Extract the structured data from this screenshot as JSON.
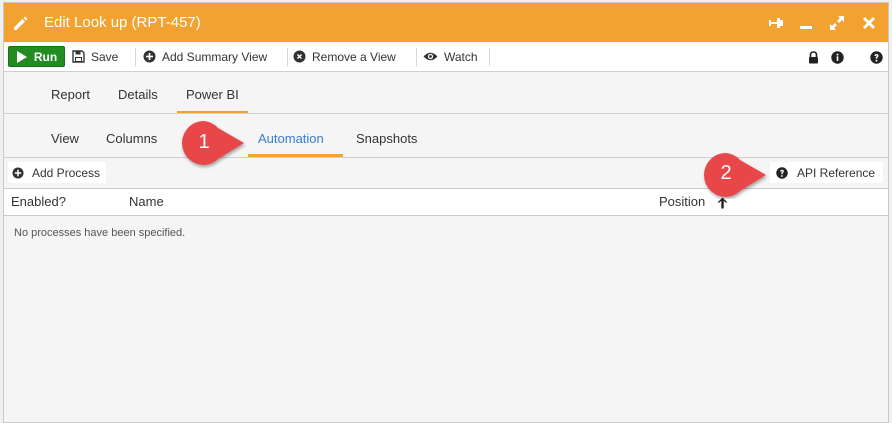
{
  "window": {
    "title": "Edit Look up (RPT-457)",
    "accent_color": "#f2a230",
    "title_icons": [
      "pin-icon",
      "minimize-icon",
      "expand-icon",
      "close-icon"
    ]
  },
  "toolbar": {
    "run_label": "Run",
    "save_label": "Save",
    "add_summary_view_label": "Add Summary View",
    "remove_view_label": "Remove a View",
    "watch_label": "Watch",
    "right_icons": [
      "lock-icon",
      "info-icon",
      "help-icon"
    ]
  },
  "tabs_primary": [
    {
      "label": "Report",
      "active": false
    },
    {
      "label": "Details",
      "active": false
    },
    {
      "label": "Power BI",
      "active": true
    }
  ],
  "tabs_secondary": [
    {
      "label": "View",
      "active": false
    },
    {
      "label": "Columns",
      "active": false
    },
    {
      "label": "Automation",
      "active": true
    },
    {
      "label": "Snapshots",
      "active": false
    }
  ],
  "actions": {
    "add_process_label": "Add Process",
    "api_reference_label": "API Reference"
  },
  "grid": {
    "columns": [
      "Enabled?",
      "Name",
      "Position"
    ],
    "empty_message": "No processes have been specified."
  },
  "callouts": [
    {
      "number": "1",
      "color": "#e8474a"
    },
    {
      "number": "2",
      "color": "#e8474a"
    }
  ]
}
